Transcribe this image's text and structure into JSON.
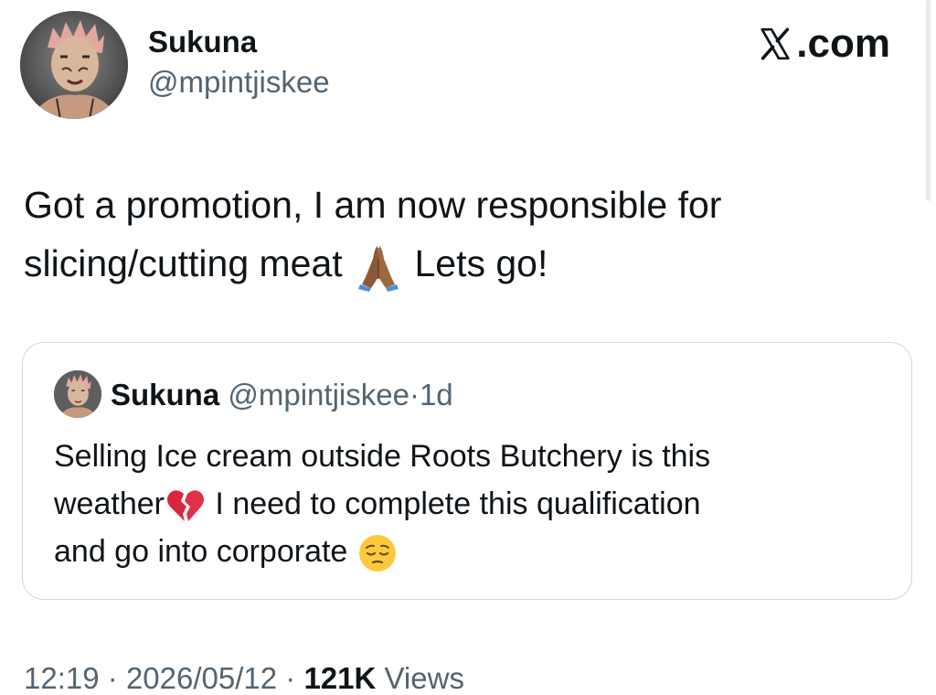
{
  "author": {
    "name": "Sukuna",
    "handle": "@mpintjiskee"
  },
  "brand": {
    "label": ".com",
    "icon": "x-logo-icon"
  },
  "tweet": {
    "line1": "Got a promotion, I am now responsible for",
    "line2_a": "slicing/cutting meat",
    "line2_emoji": "folded-hands-emoji",
    "line2_b": "Lets go!"
  },
  "quote": {
    "name": "Sukuna",
    "handle": "@mpintjiskee",
    "separator": "·",
    "time": "1d",
    "line1": "Selling Ice cream outside Roots Butchery is this",
    "line2_a": "weather",
    "line2_emoji": "broken-heart-emoji",
    "line2_b": "I need to complete this qualification",
    "line3_a": "and go into corporate",
    "line3_emoji": "pensive-face-emoji"
  },
  "footer": {
    "time": "12:19",
    "sep1": "·",
    "date": "2026/05/12",
    "sep2": "·",
    "views_count": "121K",
    "views_label": "Views"
  },
  "colors": {
    "text": "#0f1419",
    "secondary": "#536471",
    "border": "#cfd9de"
  }
}
